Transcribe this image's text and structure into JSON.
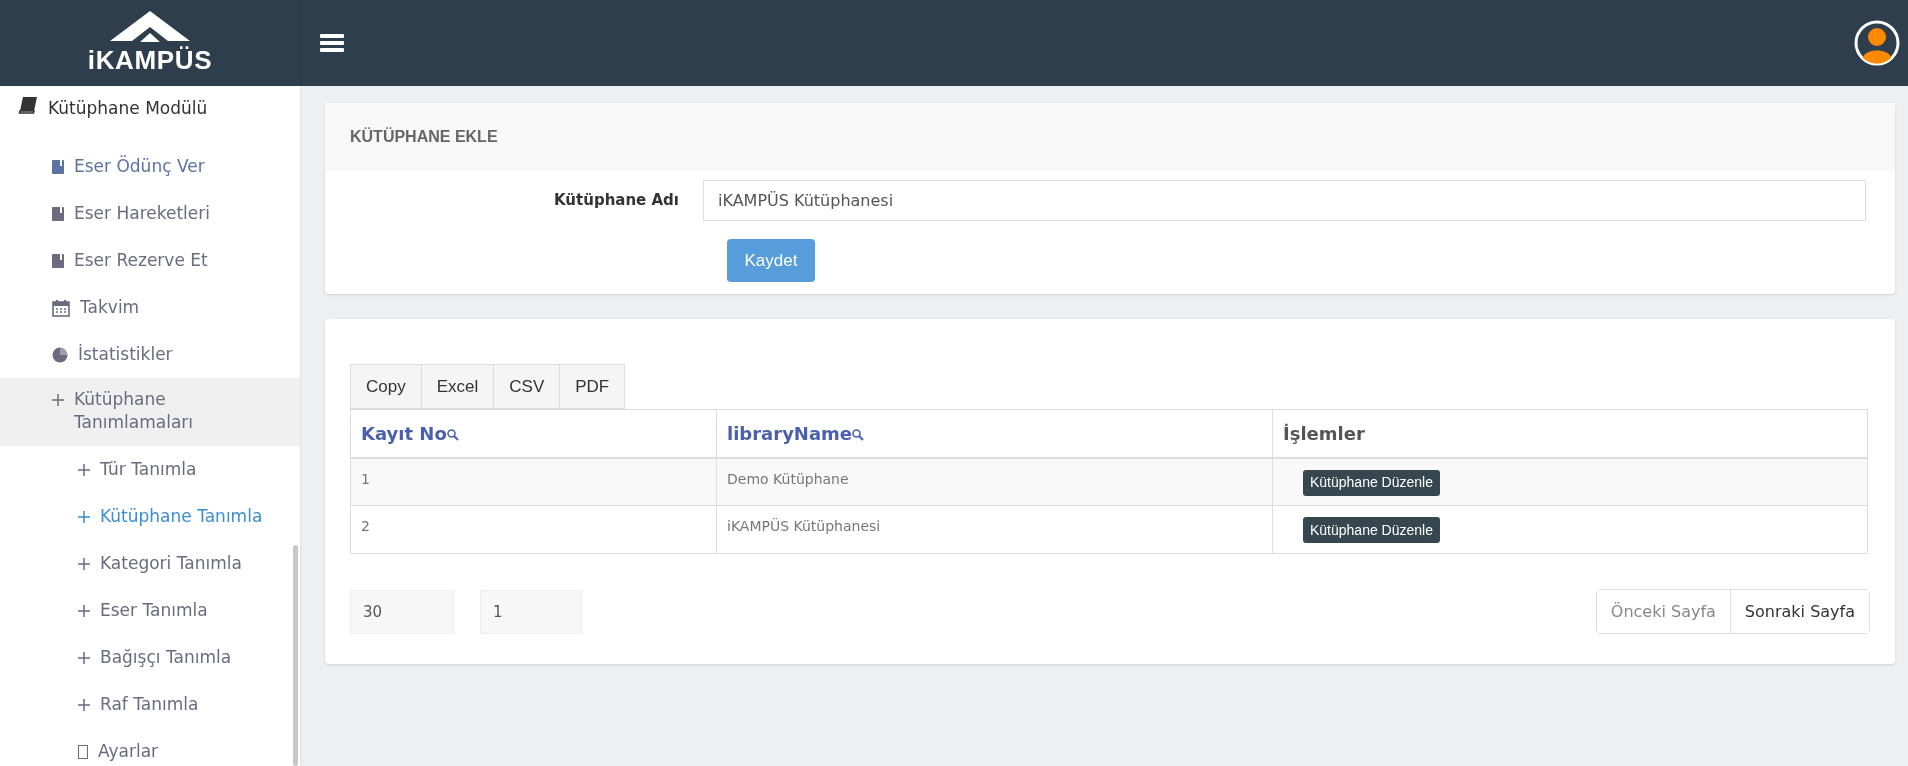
{
  "logo": {
    "text": "iKAMPÜS"
  },
  "sidebar": {
    "items": [
      {
        "label": "Kütüphane Modülü",
        "kind": "book-solid",
        "selected": false,
        "children": [
          {
            "label": "Eser Ödünç Ver",
            "kind": "book",
            "selected": false,
            "hovered": true
          },
          {
            "label": "Eser Hareketleri",
            "kind": "book",
            "selected": false,
            "hovered": false
          },
          {
            "label": "Eser Rezerve Et",
            "kind": "book",
            "selected": false,
            "hovered": false
          },
          {
            "label": "Takvim",
            "kind": "calendar",
            "selected": false,
            "hovered": false
          },
          {
            "label": "İstatistikler",
            "kind": "pie",
            "selected": false,
            "hovered": false
          },
          {
            "label": "Kütüphane Tanımlamaları",
            "kind": "plus",
            "selected": false,
            "hovered": false,
            "expanded": true,
            "children": [
              {
                "label": "Tür Tanımla",
                "kind": "plus",
                "selected": false
              },
              {
                "label": "Kütüphane Tanımla",
                "kind": "plus",
                "selected": true
              },
              {
                "label": "Kategori Tanımla",
                "kind": "plus",
                "selected": false
              },
              {
                "label": "Eser Tanımla",
                "kind": "plus",
                "selected": false
              },
              {
                "label": "Bağışçı Tanımla",
                "kind": "plus",
                "selected": false
              },
              {
                "label": "Raf Tanımla",
                "kind": "plus",
                "selected": false
              },
              {
                "label": "Ayarlar",
                "kind": "box",
                "selected": false
              }
            ]
          }
        ]
      }
    ]
  },
  "form": {
    "title": "KÜTÜPHANE EKLE",
    "label": "Kütüphane Adı",
    "value": "iKAMPÜS Kütüphanesi",
    "submit": "Kaydet"
  },
  "table": {
    "export_buttons": [
      "Copy",
      "Excel",
      "CSV",
      "PDF"
    ],
    "columns": [
      {
        "label": "Kayıt No",
        "searchable": true
      },
      {
        "label": "libraryName",
        "searchable": true
      },
      {
        "label": "İşlemler",
        "searchable": false
      }
    ],
    "rows": [
      {
        "cells": [
          "1",
          "Demo Kütüphane"
        ],
        "action": "Kütüphane Düzenle"
      },
      {
        "cells": [
          "2",
          "iKAMPÜS Kütüphanesi"
        ],
        "action": "Kütüphane Düzenle"
      }
    ],
    "page_size": "30",
    "page": "1",
    "pagination": [
      {
        "label": "Önceki Sayfa",
        "disabled": true
      },
      {
        "label": "Sonraki Sayfa",
        "disabled": false
      }
    ]
  }
}
